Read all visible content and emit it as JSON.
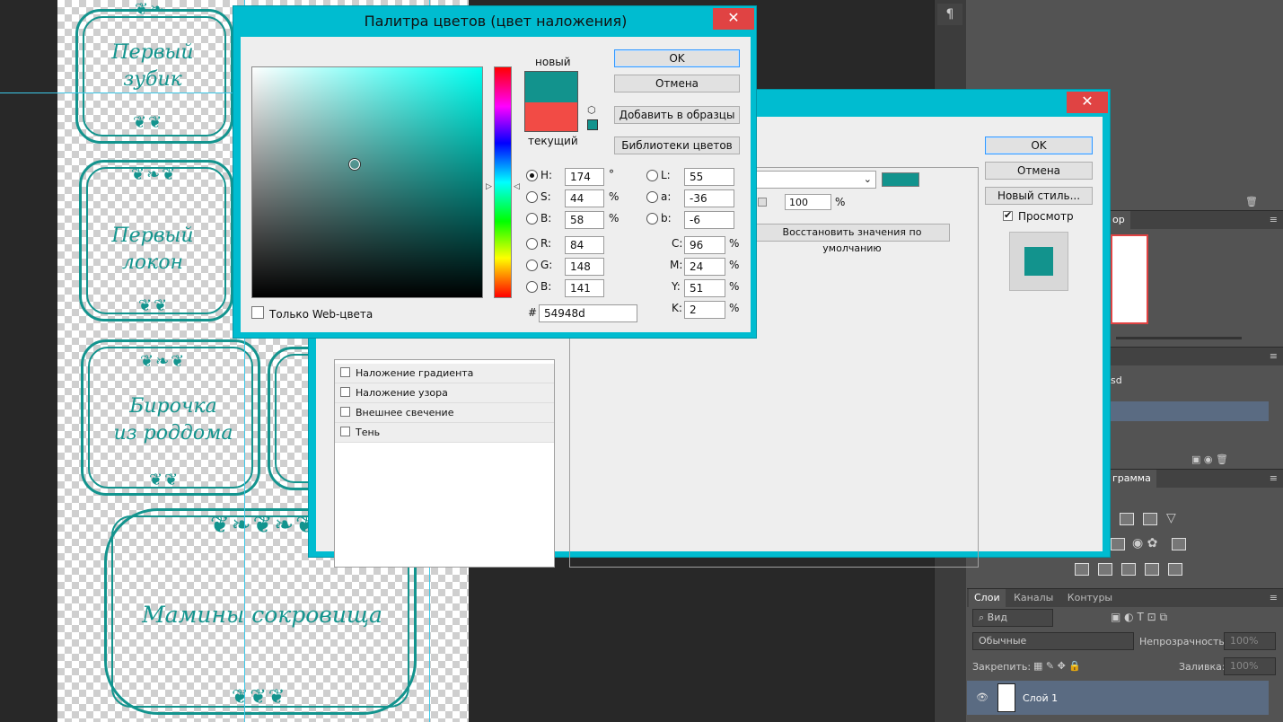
{
  "document": {
    "labels": [
      {
        "line1": "Первый",
        "line2": "зубик"
      },
      {
        "line1": "Первый",
        "line2": "локон"
      },
      {
        "line1": "Бирочка",
        "line2": "из роддома"
      },
      {
        "line1": "Мамины сокровища",
        "line2": ""
      }
    ]
  },
  "color_picker": {
    "title": "Палитра цветов (цвет наложения)",
    "close_glyph": "✕",
    "new_label": "новый",
    "current_label": "текущий",
    "new_color": "#12938d",
    "current_color": "#f24b45",
    "buttons": {
      "ok": "OK",
      "cancel": "Отмена",
      "add_swatches": "Добавить в образцы",
      "color_libraries": "Библиотеки цветов"
    },
    "web_only_label": "Только Web-цвета",
    "fields": {
      "H": {
        "label": "H:",
        "value": "174",
        "unit": "°"
      },
      "S": {
        "label": "S:",
        "value": "44",
        "unit": "%"
      },
      "B": {
        "label": "B:",
        "value": "58",
        "unit": "%"
      },
      "R": {
        "label": "R:",
        "value": "84"
      },
      "G": {
        "label": "G:",
        "value": "148"
      },
      "Bv": {
        "label": "B:",
        "value": "141"
      },
      "L": {
        "label": "L:",
        "value": "55"
      },
      "a": {
        "label": "a:",
        "value": "-36"
      },
      "b": {
        "label": "b:",
        "value": "-6"
      },
      "C": {
        "label": "C:",
        "value": "96",
        "unit": "%"
      },
      "M": {
        "label": "M:",
        "value": "24",
        "unit": "%"
      },
      "Y": {
        "label": "Y:",
        "value": "51",
        "unit": "%"
      },
      "K": {
        "label": "K:",
        "value": "2",
        "unit": "%"
      }
    },
    "hex_label": "#",
    "hex_value": "54948d"
  },
  "layer_style": {
    "close_glyph": "✕",
    "buttons": {
      "ok": "OK",
      "cancel": "Отмена",
      "new_style": "Новый стиль...",
      "reset_defaults": "Восстановить значения по умолчанию"
    },
    "preview_label": "Просмотр",
    "opacity_value": "100",
    "opacity_unit": "%",
    "overlay_color": "#12938d",
    "style_items": [
      "Наложение градиента",
      "Наложение узора",
      "Внешнее свечение",
      "Тень"
    ]
  },
  "ps_panels": {
    "paragraph_icon": "¶",
    "trash_icon": "🗑",
    "navigator_tab_fragment": "ор",
    "file_fragment": "sd",
    "adjust_tab_fragment": "грамма",
    "layers_tabs": [
      "Слои",
      "Каналы",
      "Контуры"
    ],
    "filter_label": "Вид",
    "blend_mode": "Обычные",
    "opacity_label": "Непрозрачность:",
    "opacity_value": "100%",
    "lock_label": "Закрепить:",
    "fill_label": "Заливка:",
    "fill_value": "100%",
    "layer_name": "Слой 1",
    "menu_glyph": "≡"
  }
}
